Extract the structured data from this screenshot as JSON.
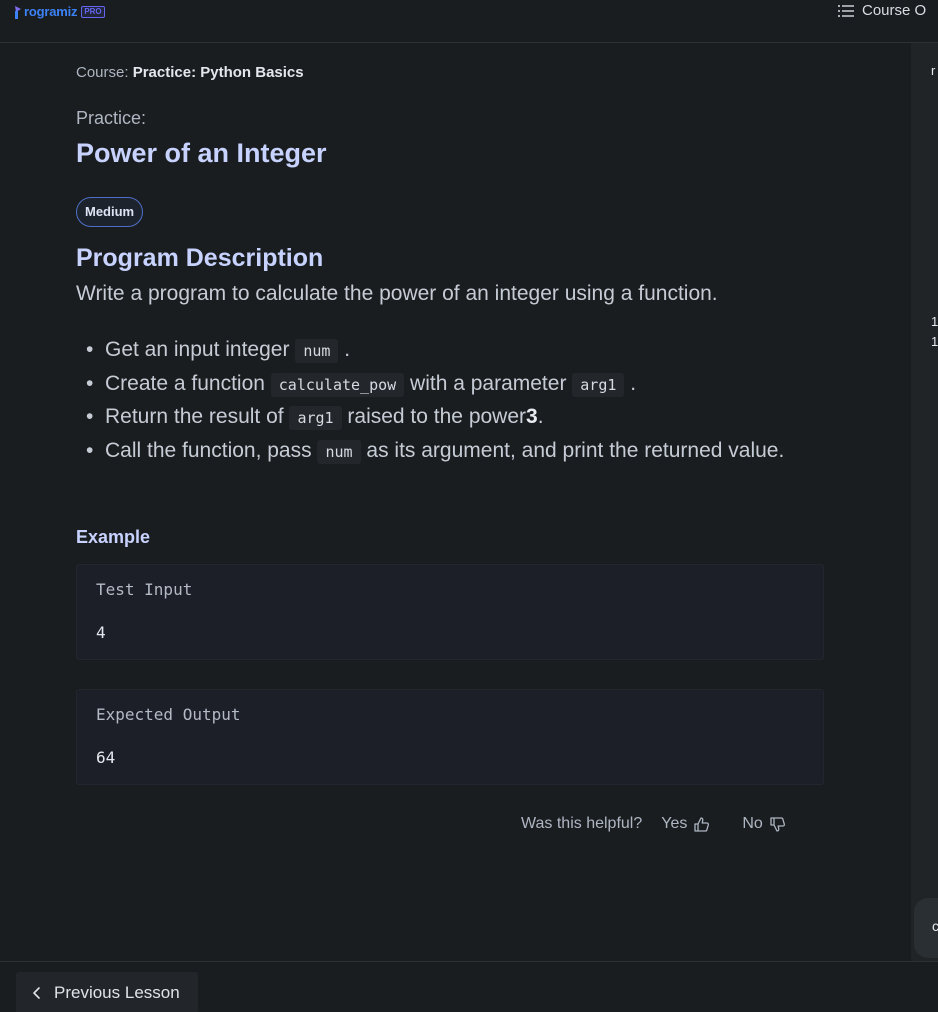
{
  "header": {
    "logo_text": "rogramiz",
    "logo_badge": "PRO",
    "course_outline_label": "Course O",
    "course_outline_icon": "list-icon"
  },
  "breadcrumb": {
    "prefix": "Course:",
    "course_name": "Practice: Python Basics"
  },
  "lesson": {
    "kind_label": "Practice:",
    "title": "Power of an Integer",
    "difficulty": "Medium",
    "section_heading": "Program Description",
    "description": "Write a program to calculate the power of an integer using a function.",
    "bullets": {
      "b1_text": "Get an input integer",
      "b1_code": "num",
      "b1_end": ".",
      "b2_text": "Create a function",
      "b2_code": "calculate_pow",
      "b2_mid": "with a parameter",
      "b2_code2": "arg1",
      "b2_end": ".",
      "b3_text": "Return the result of",
      "b3_code": "arg1",
      "b3_mid": "raised to the power",
      "b3_bold": "3",
      "b3_end": ".",
      "b4_text": "Call the function, pass",
      "b4_code": "num",
      "b4_mid": "as its argument, and print the returned value."
    },
    "example_heading": "Example",
    "test_input_label": "Test Input",
    "test_input_value": "4",
    "expected_output_label": "Expected Output",
    "expected_output_value": "64"
  },
  "feedback": {
    "question": "Was this helpful?",
    "yes_label": "Yes",
    "no_label": "No"
  },
  "footer": {
    "previous_label": "Previous Lesson"
  },
  "right_panel": {
    "frag_top": "r",
    "frag_mid1": "1",
    "frag_mid2": "1",
    "frag_bottom": "c"
  },
  "colors": {
    "background": "#1a1d1f",
    "heading": "#c7d2fe",
    "brand": "#3b82f6",
    "pro_badge": "#6366f1"
  }
}
